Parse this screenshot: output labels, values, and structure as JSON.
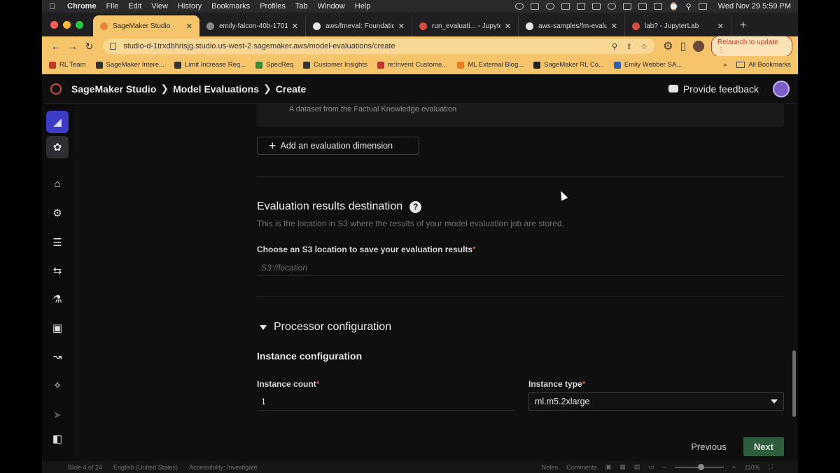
{
  "macos_menubar": {
    "app": "Chrome",
    "items": [
      "File",
      "Edit",
      "View",
      "History",
      "Bookmarks",
      "Profiles",
      "Tab",
      "Window",
      "Help"
    ],
    "clock": "Wed Nov 29  5:59 PM"
  },
  "browser": {
    "tabs": [
      {
        "title": "SageMaker Studio",
        "active": true,
        "favicon_color": "#e8833a"
      },
      {
        "title": "emily-falcon-40b-1701",
        "active": false,
        "favicon_color": "#888888"
      },
      {
        "title": "aws/fmeval: Foundation",
        "active": false,
        "favicon_color": "#e6e6e6"
      },
      {
        "title": "run_evaluati... - Jupyte",
        "active": false,
        "favicon_color": "#d24d3c"
      },
      {
        "title": "aws-samples/fm-evalu",
        "active": false,
        "favicon_color": "#e6e6e6"
      },
      {
        "title": "lab? - JupyterLab",
        "active": false,
        "favicon_color": "#d24d3c"
      }
    ],
    "url": "studio-d-1trxdbhrisjg.studio.us-west-2.sagemaker.aws/model-evaluations/create",
    "relaunch_label": "Relaunch to update",
    "bookmarks": [
      {
        "label": "RL Team",
        "color": "#c0392b"
      },
      {
        "label": "SageMaker Intere...",
        "color": "#333333"
      },
      {
        "label": "Limit Increase Req...",
        "color": "#333333"
      },
      {
        "label": "SpecReq",
        "color": "#3a8a3a"
      },
      {
        "label": "Customer Insights",
        "color": "#333333"
      },
      {
        "label": "re:Invent Custome...",
        "color": "#c0392b"
      },
      {
        "label": "ML External Blog...",
        "color": "#e67e22"
      },
      {
        "label": "SageMaker RL Co...",
        "color": "#222222"
      },
      {
        "label": "Emily Webber SA...",
        "color": "#2f5fb3"
      }
    ],
    "all_bookmarks_label": "All Bookmarks"
  },
  "studio": {
    "breadcrumb": [
      "SageMaker Studio",
      "Model Evaluations",
      "Create"
    ],
    "feedback_label": "Provide feedback",
    "dataset_card_text": "A dataset from the Factual Knowledge evaluation",
    "add_dimension_label": "Add an evaluation dimension",
    "results_section": {
      "title": "Evaluation results destination",
      "description": "This is the location in S3 where the results of your model evaluation job are stored.",
      "s3_label": "Choose an S3 location to save your evaluation results",
      "s3_placeholder": "S3://location",
      "s3_value": ""
    },
    "processor_section": {
      "title": "Processor configuration",
      "subtitle": "Instance configuration",
      "count_label": "Instance count",
      "count_value": "1",
      "type_label": "Instance type",
      "type_value": "ml.m5.2xlarge"
    },
    "required_marker": "*",
    "previous_label": "Previous",
    "next_label": "Next"
  },
  "statusbar": {
    "slide": "Slide 4 of 24",
    "language": "English (United States)",
    "accessibility": "Accessibility: Investigate",
    "notes": "Notes",
    "comments": "Comments",
    "zoom": "110%"
  }
}
